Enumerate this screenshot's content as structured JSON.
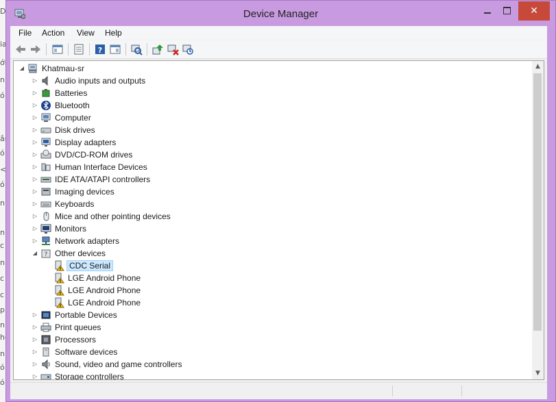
{
  "window": {
    "title": "Device Manager"
  },
  "background_fragments": [
    "D",
    "ia",
    "ới",
    "n",
    "ó",
    "ắn",
    "ó",
    "<",
    "ó",
    "n",
    "ni",
    "c",
    "n",
    "c",
    "c",
    "p",
    "n",
    "hỏ",
    "n",
    "ó",
    "ó"
  ],
  "menu": [
    {
      "label": "File"
    },
    {
      "label": "Action"
    },
    {
      "label": "View"
    },
    {
      "label": "Help"
    }
  ],
  "toolbar": [
    {
      "name": "back-icon"
    },
    {
      "name": "forward-icon"
    },
    {
      "name": "show-hide-console-tree-icon"
    },
    {
      "name": "properties-icon"
    },
    {
      "name": "help-icon"
    },
    {
      "name": "show-action-pane-icon"
    },
    {
      "name": "scan-hardware-icon"
    },
    {
      "name": "update-driver-icon"
    },
    {
      "name": "disable-device-icon"
    },
    {
      "name": "uninstall-device-icon"
    }
  ],
  "tree": {
    "root": "Khatmau-sr",
    "items": [
      {
        "label": "Audio inputs and outputs",
        "icon": "speaker-icon",
        "level": 1,
        "state": "collapsed"
      },
      {
        "label": "Batteries",
        "icon": "battery-icon",
        "level": 1,
        "state": "collapsed"
      },
      {
        "label": "Bluetooth",
        "icon": "bluetooth-icon",
        "level": 1,
        "state": "collapsed"
      },
      {
        "label": "Computer",
        "icon": "computer-icon",
        "level": 1,
        "state": "collapsed"
      },
      {
        "label": "Disk drives",
        "icon": "disk-drive-icon",
        "level": 1,
        "state": "collapsed"
      },
      {
        "label": "Display adapters",
        "icon": "display-adapter-icon",
        "level": 1,
        "state": "collapsed"
      },
      {
        "label": "DVD/CD-ROM drives",
        "icon": "dvd-drive-icon",
        "level": 1,
        "state": "collapsed"
      },
      {
        "label": "Human Interface Devices",
        "icon": "hid-icon",
        "level": 1,
        "state": "collapsed"
      },
      {
        "label": "IDE ATA/ATAPI controllers",
        "icon": "ide-controller-icon",
        "level": 1,
        "state": "collapsed"
      },
      {
        "label": "Imaging devices",
        "icon": "imaging-device-icon",
        "level": 1,
        "state": "collapsed"
      },
      {
        "label": "Keyboards",
        "icon": "keyboard-icon",
        "level": 1,
        "state": "collapsed"
      },
      {
        "label": "Mice and other pointing devices",
        "icon": "mouse-icon",
        "level": 1,
        "state": "collapsed"
      },
      {
        "label": "Monitors",
        "icon": "monitor-icon",
        "level": 1,
        "state": "collapsed"
      },
      {
        "label": "Network adapters",
        "icon": "network-adapter-icon",
        "level": 1,
        "state": "collapsed"
      },
      {
        "label": "Other devices",
        "icon": "unknown-device-icon",
        "level": 1,
        "state": "expanded"
      },
      {
        "label": "CDC Serial",
        "icon": "warning-device-icon",
        "level": 2,
        "state": "leaf",
        "selected": true
      },
      {
        "label": "LGE Android Phone",
        "icon": "warning-device-icon",
        "level": 2,
        "state": "leaf"
      },
      {
        "label": "LGE Android Phone",
        "icon": "warning-device-icon",
        "level": 2,
        "state": "leaf"
      },
      {
        "label": "LGE Android Phone",
        "icon": "warning-device-icon",
        "level": 2,
        "state": "leaf"
      },
      {
        "label": "Portable Devices",
        "icon": "portable-device-icon",
        "level": 1,
        "state": "collapsed"
      },
      {
        "label": "Print queues",
        "icon": "printer-icon",
        "level": 1,
        "state": "collapsed"
      },
      {
        "label": "Processors",
        "icon": "processor-icon",
        "level": 1,
        "state": "collapsed"
      },
      {
        "label": "Software devices",
        "icon": "software-device-icon",
        "level": 1,
        "state": "collapsed"
      },
      {
        "label": "Sound, video and game controllers",
        "icon": "sound-controller-icon",
        "level": 1,
        "state": "collapsed"
      },
      {
        "label": "Storage controllers",
        "icon": "storage-controller-icon",
        "level": 1,
        "state": "collapsed"
      }
    ]
  },
  "colors": {
    "frame": "#c89ae0",
    "close": "#c7493a",
    "selection": "#cce8ff"
  }
}
